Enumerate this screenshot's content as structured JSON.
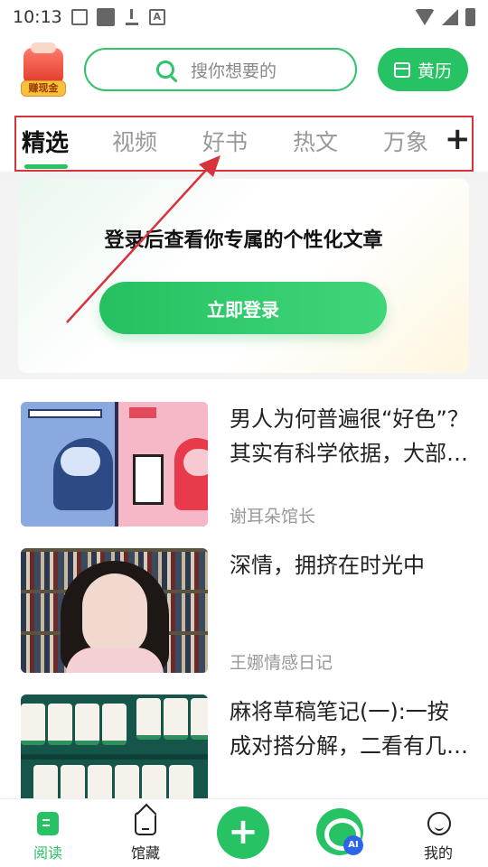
{
  "status_bar": {
    "time": "10:13"
  },
  "header": {
    "earn_label": "赚现金",
    "search_placeholder": "搜你想要的",
    "calendar_label": "黄历"
  },
  "tabs": [
    {
      "label": "精选",
      "active": true
    },
    {
      "label": "视频",
      "active": false
    },
    {
      "label": "好书",
      "active": false
    },
    {
      "label": "热文",
      "active": false
    },
    {
      "label": "万象",
      "active": false
    }
  ],
  "tabs_add": "+",
  "login": {
    "message": "登录后查看你专属的个性化文章",
    "button": "立即登录"
  },
  "articles": [
    {
      "title": "男人为何普遍很“好色”？其实有科学依据，大部分...",
      "source": "谢耳朵馆长"
    },
    {
      "title": "深情，拥挤在时光中",
      "source": "王娜情感日记"
    },
    {
      "title": "麻将草稿笔记(一):一按成对搭分解，二看有几个刻子...",
      "source": ""
    }
  ],
  "bottom_nav": {
    "read": "阅读",
    "collection": "馆藏",
    "add": "+",
    "ai_badge": "AI",
    "mine": "我的"
  },
  "colors": {
    "accent": "#27c264",
    "annotation": "#d8323a"
  }
}
